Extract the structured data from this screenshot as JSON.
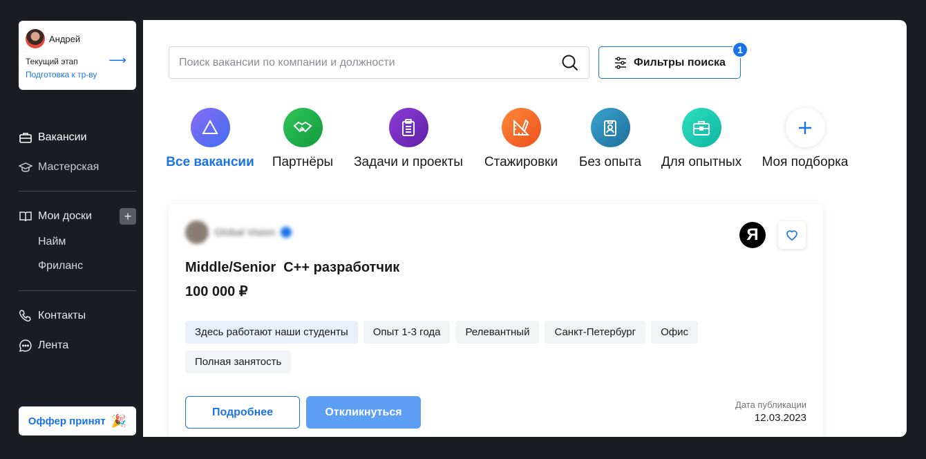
{
  "profile": {
    "name": "Андрей",
    "stage_label": "Текущий этап",
    "stage_value": "Подготовка к тр-ву"
  },
  "nav": {
    "vacancies": "Вакансии",
    "workshop": "Мастерская",
    "boards": "Мои доски",
    "board_items": [
      "Найм",
      "Фриланс"
    ],
    "contacts": "Контакты",
    "feed": "Лента"
  },
  "offer": {
    "label": "Оффер принят"
  },
  "search": {
    "placeholder": "Поиск вакансии по компании и должности"
  },
  "filters": {
    "label": "Фильтры поиска",
    "badge": "1",
    "accent": "#1a73e8"
  },
  "categories": [
    {
      "label": "Все вакансии",
      "icon": "all-vacancies-icon",
      "color": "#6b5cf0"
    },
    {
      "label": "Партнёры",
      "icon": "handshake-icon",
      "color": "#1fb34a"
    },
    {
      "label": "Задачи и проекты",
      "icon": "clipboard-icon",
      "color": "#7a2fc1"
    },
    {
      "label": "Стажировки",
      "icon": "ruler-pencil-icon",
      "color": "#f56a2a"
    },
    {
      "label": "Без опыта",
      "icon": "badge-id-icon",
      "color": "#2a8fbd"
    },
    {
      "label": "Для опытных",
      "icon": "briefcase-icon",
      "color": "#16c7b0"
    },
    {
      "label": "Моя подборка",
      "icon": "plus-icon",
      "color": "#1a73e8"
    }
  ],
  "job": {
    "company": "Global Vision",
    "title": "Middle/Senior  C++ разработчик",
    "salary": "100 000 ₽",
    "tags": [
      "Здесь работают наши студенты",
      "Опыт 1-3 года",
      "Релевантный",
      "Санкт-Петербург",
      "Офис",
      "Полная занятость"
    ],
    "more_label": "Подробнее",
    "apply_label": "Откликнуться",
    "pub_label": "Дата публикации",
    "pub_date": "12.03.2023",
    "brand_letter": "Я"
  }
}
